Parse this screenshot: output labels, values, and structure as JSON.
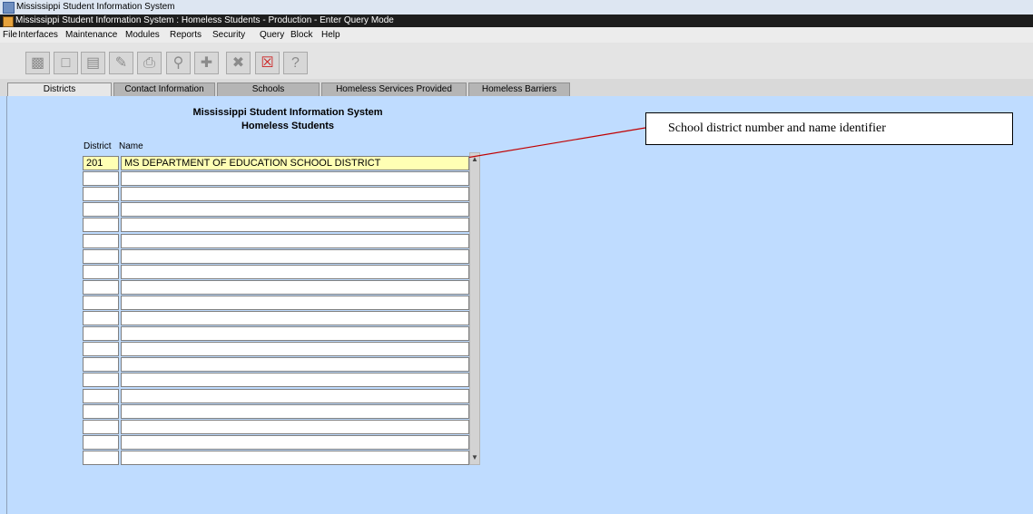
{
  "window": {
    "outer_title": "Mississippi Student Information System",
    "inner_title": "Mississippi Student Information System : Homeless Students  -  Production  -  Enter Query Mode"
  },
  "menu": [
    "File",
    "Interfaces",
    "Maintenance",
    "Modules",
    "Reports",
    "Security",
    "Query",
    "Block",
    "Help"
  ],
  "toolbar": {
    "icons": [
      "save-icon",
      "open-icon",
      "document-icon",
      "pencil-icon",
      "print-icon",
      "search-icon",
      "plus-icon",
      "delete-icon",
      "exit-icon",
      "help-icon"
    ]
  },
  "tabs": [
    {
      "label": "Districts",
      "active": true
    },
    {
      "label": "Contact Information",
      "active": false
    },
    {
      "label": "Schools",
      "active": false
    },
    {
      "label": "Homeless Services Provided",
      "active": false
    },
    {
      "label": "Homeless Barriers",
      "active": false
    }
  ],
  "form": {
    "heading1": "Mississippi Student Information System",
    "heading2": "Homeless Students",
    "col_district": "District",
    "col_name": "Name",
    "rows": [
      {
        "district": "201",
        "name": "MS DEPARTMENT OF EDUCATION SCHOOL DISTRICT"
      },
      {
        "district": "",
        "name": ""
      },
      {
        "district": "",
        "name": ""
      },
      {
        "district": "",
        "name": ""
      },
      {
        "district": "",
        "name": ""
      },
      {
        "district": "",
        "name": ""
      },
      {
        "district": "",
        "name": ""
      },
      {
        "district": "",
        "name": ""
      },
      {
        "district": "",
        "name": ""
      },
      {
        "district": "",
        "name": ""
      },
      {
        "district": "",
        "name": ""
      },
      {
        "district": "",
        "name": ""
      },
      {
        "district": "",
        "name": ""
      },
      {
        "district": "",
        "name": ""
      },
      {
        "district": "",
        "name": ""
      },
      {
        "district": "",
        "name": ""
      },
      {
        "district": "",
        "name": ""
      },
      {
        "district": "",
        "name": ""
      },
      {
        "district": "",
        "name": ""
      },
      {
        "district": "",
        "name": ""
      }
    ]
  },
  "callout": {
    "text": "School district number and name identifier",
    "arrow_color": "#c00000"
  },
  "colors": {
    "main_bg": "#bfdcff",
    "selected_row": "#ffffb4"
  }
}
